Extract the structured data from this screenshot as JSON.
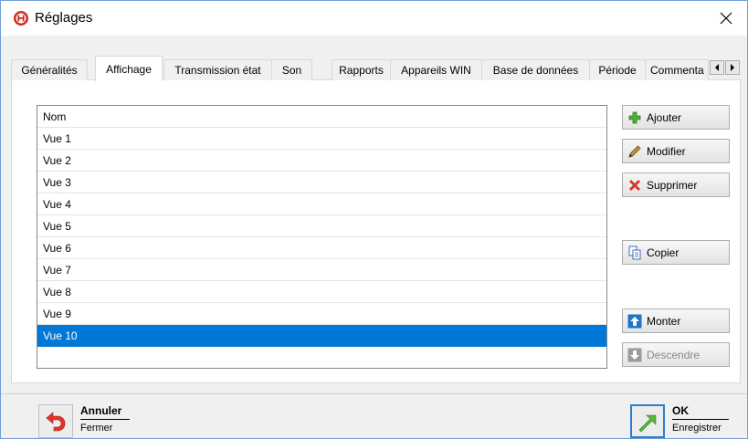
{
  "window": {
    "title": "Réglages"
  },
  "tabs": [
    {
      "label": "Généralités"
    },
    {
      "label": "Affichage",
      "active": true
    },
    {
      "label": "Transmission état"
    },
    {
      "label": "Son"
    },
    {
      "label": "Rapports"
    },
    {
      "label": "Appareils WIN"
    },
    {
      "label": "Base de données"
    },
    {
      "label": "Période"
    },
    {
      "label": "Commenta"
    }
  ],
  "list": {
    "header": "Nom",
    "items": [
      "Vue 1",
      "Vue 2",
      "Vue 3",
      "Vue 4",
      "Vue 5",
      "Vue 6",
      "Vue 7",
      "Vue 8",
      "Vue 9",
      "Vue 10"
    ],
    "selected_item": "Vue 10"
  },
  "buttons": {
    "add": "Ajouter",
    "edit": "Modifier",
    "delete": "Supprimer",
    "copy": "Copier",
    "up": "Monter",
    "down": "Descendre"
  },
  "footer": {
    "cancel": {
      "label": "Annuler",
      "sublabel": "Fermer"
    },
    "ok": {
      "label": "OK",
      "sublabel": "Enregistrer"
    }
  },
  "icons": {
    "app": "app-logo-icon",
    "close": "close-icon",
    "add": "plus-icon",
    "edit": "pencil-icon",
    "delete": "red-x-icon",
    "copy": "copy-icon",
    "up": "arrow-up-icon",
    "down": "arrow-down-icon",
    "cancel": "undo-arrow-icon",
    "ok": "ok-arrow-icon"
  },
  "colors": {
    "selection": "#0078d7",
    "brand_red": "#d22a21",
    "ok_border": "#2d7fd1",
    "ok_green": "#5cb83a"
  }
}
